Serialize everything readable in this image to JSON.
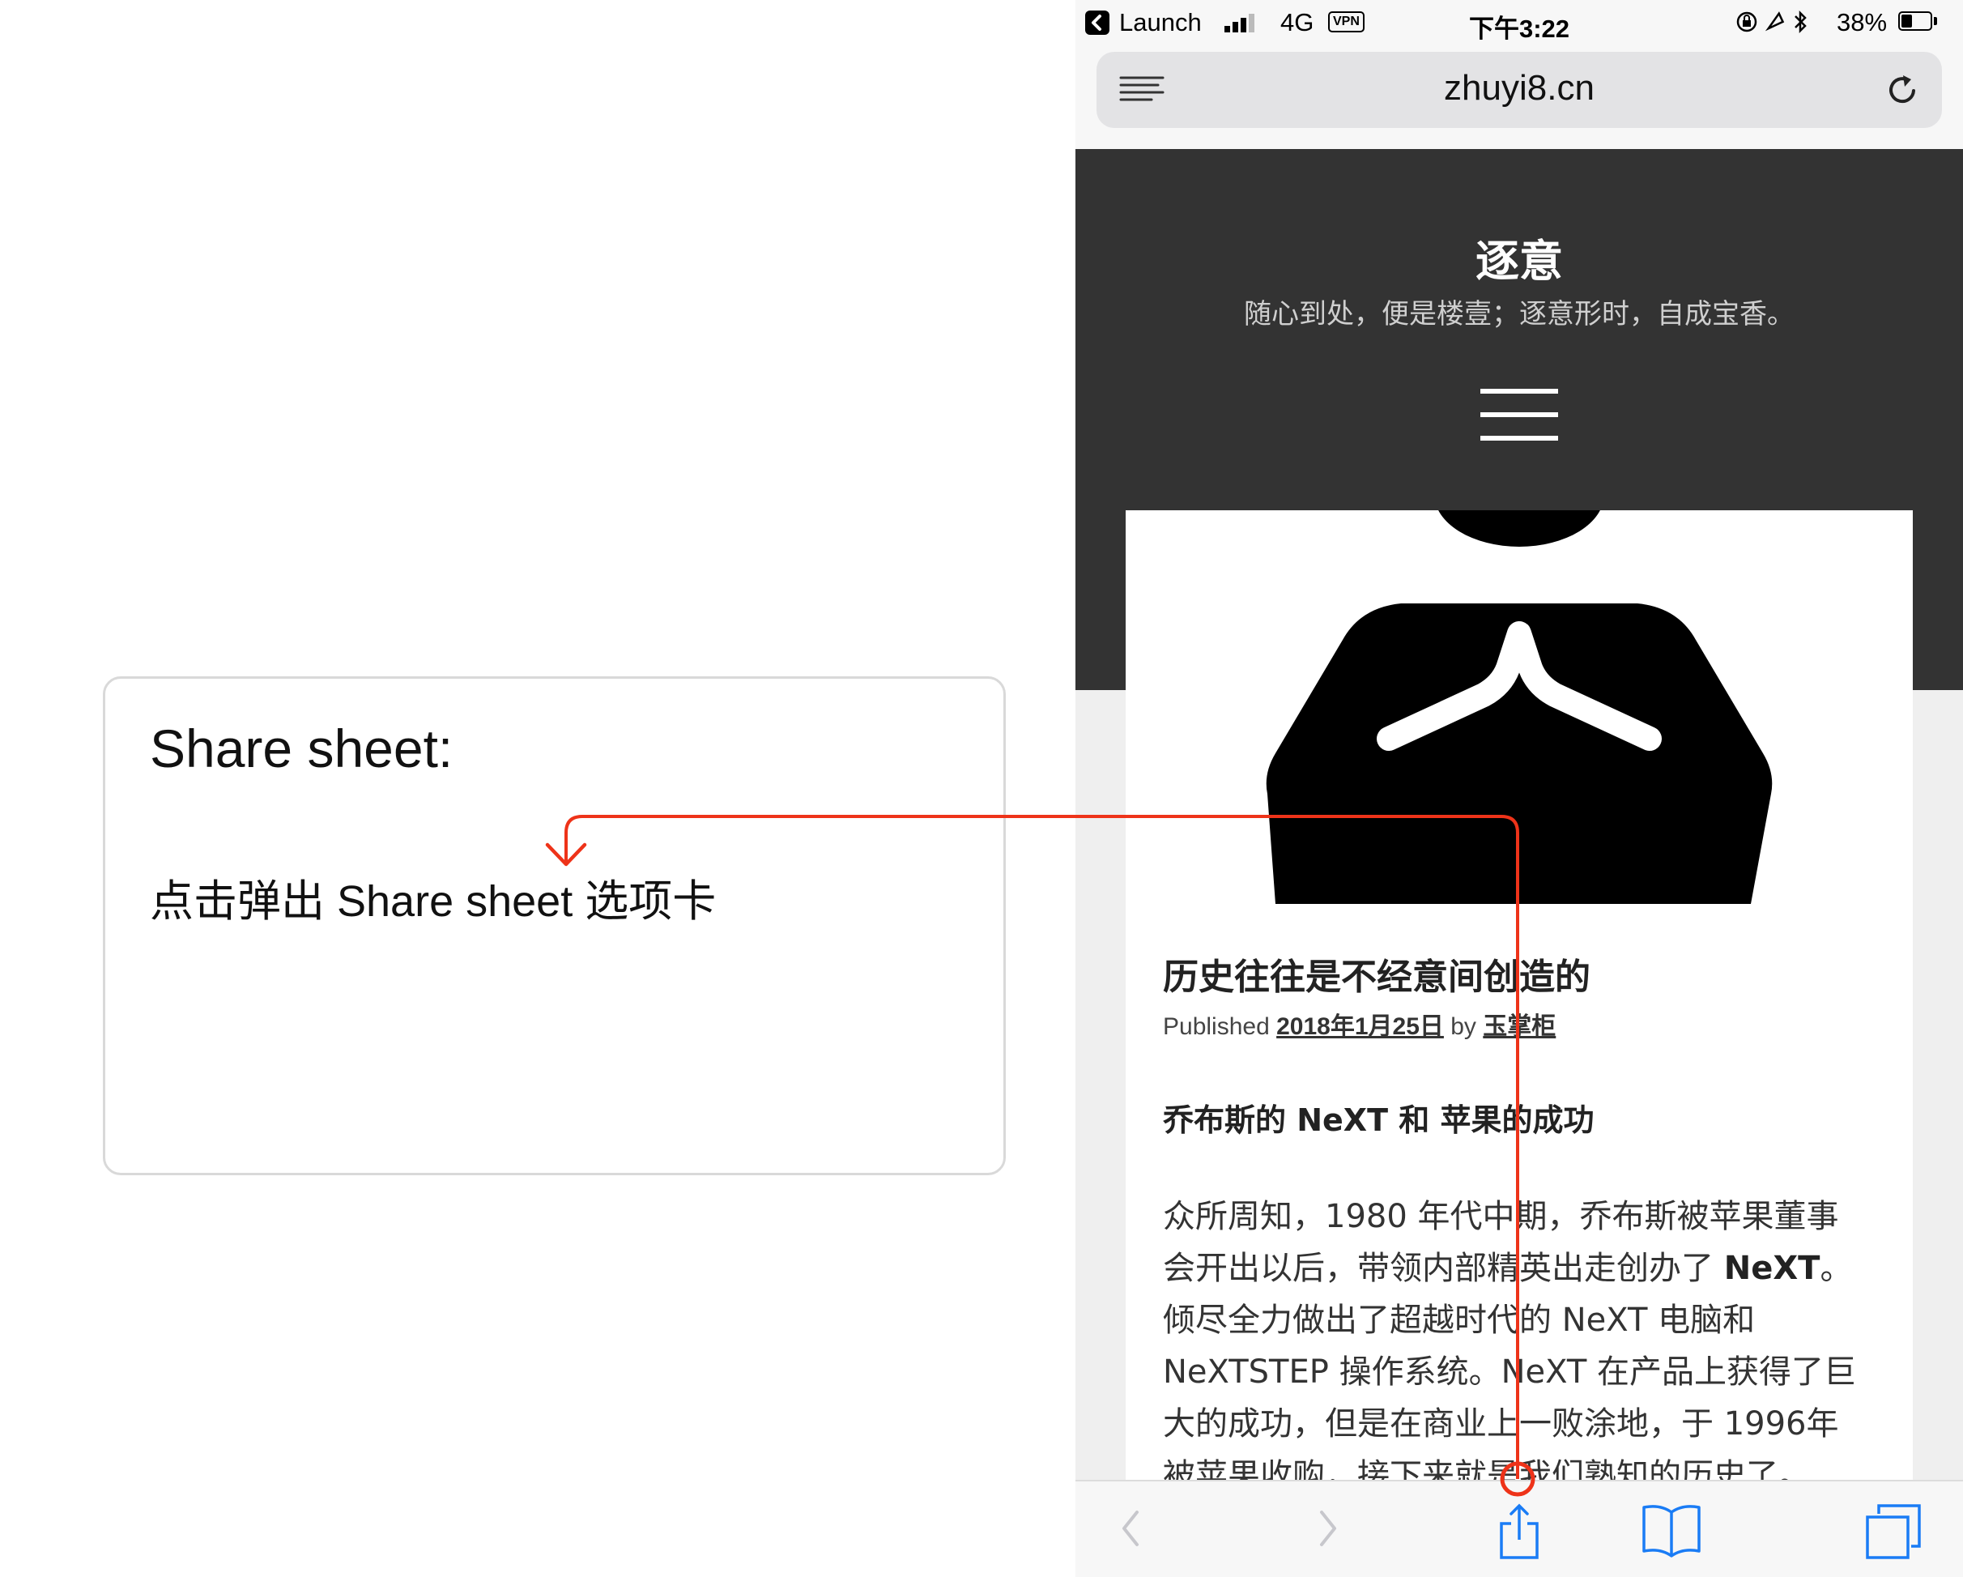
{
  "annotation": {
    "title": "Share sheet:",
    "body": "点击弹出 Share sheet 选项卡",
    "arrow_color": "#ee3319"
  },
  "status_bar": {
    "back_app": "Launch",
    "network": "4G",
    "vpn": "VPN",
    "time": "下午3:22",
    "battery_text": "38%",
    "battery_level": 0.38
  },
  "browser": {
    "url": "zhuyi8.cn",
    "icons": {
      "reader": "reader-view-icon",
      "reload": "reload-icon",
      "back": "chevron-left-icon",
      "forward": "chevron-right-icon",
      "share": "share-icon",
      "bookmarks": "book-icon",
      "tabs": "tabs-icon"
    }
  },
  "site": {
    "title": "逐意",
    "tagline": "随心到处，便是楼壹；逐意形时，自成宝香。",
    "menu_icon": "hamburger-menu-icon",
    "header_color": "#333333"
  },
  "post": {
    "title": "历史往往是不经意间创造的",
    "meta_prefix": "Published",
    "date": "2018年1月25日",
    "meta_by": "by",
    "author": "玉掌柜",
    "subheading": "乔布斯的 NeXT 和 苹果的成功",
    "lines": [
      {
        "pre": "众所周知，1980 年代中期，乔布斯被苹果董事",
        "bold": "",
        "post": ""
      },
      {
        "pre": "会开出以后，带领内部精英出走创办了 ",
        "bold": "NeXT",
        "post": "。"
      },
      {
        "pre": "倾尽全力做出了超越时代的 NeXT 电脑和",
        "bold": "",
        "post": ""
      },
      {
        "pre": "NeXTSTEP 操作系统。NeXT 在产品上获得了巨",
        "bold": "",
        "post": ""
      },
      {
        "pre": "大的成功，但是在商业上一败涂地，于 1996年",
        "bold": "",
        "post": ""
      },
      {
        "pre": "被苹果收购，接下来就是我们熟知的历史了。",
        "bold": "",
        "post": ""
      }
    ]
  }
}
